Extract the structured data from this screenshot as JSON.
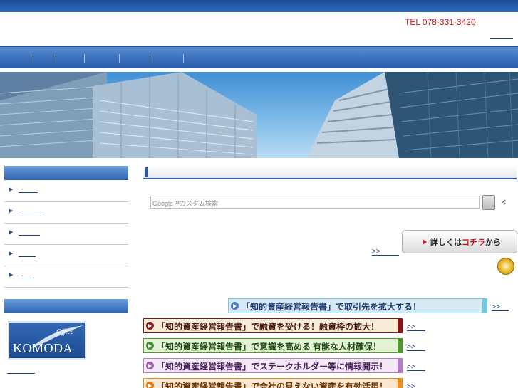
{
  "header": {
    "tel": "TEL 078-331-3420"
  },
  "search": {
    "brand": "Google™カスタム検索",
    "clear": "×"
  },
  "detail_button": {
    "prefix": "詳しくは",
    "highlight": "コチラ",
    "suffix": "から"
  },
  "more_label": ">>",
  "banners": [
    {
      "text": "「知的資産経営報告書」で取引先を拡大する！",
      "bg": "#d7eaf3",
      "color": "#1f3c73",
      "icon": "#4a7fc0",
      "accent": "#73c9e3"
    },
    {
      "text": "「知的資産経営報告書」で融資を受ける！融資枠の拡大！",
      "bg": "#f6ecd8",
      "color": "#4a1a10",
      "icon": "#8b1a1a",
      "accent": "#8b1414"
    },
    {
      "text": "「知的資産経営報告書」で意識を高める 有能な人材確保！",
      "bg": "#e5f2d6",
      "color": "#1d4a12",
      "icon": "#3f8f2a",
      "accent": "#4e9a2e"
    },
    {
      "text": "「知的資産経営報告書」でステークホルダー等に情報開示！",
      "bg": "#f3e8f6",
      "color": "#4a1f5e",
      "icon": "#9b5fb5",
      "accent": "#b57cc8"
    },
    {
      "text": "「知的資産経営報告書」で会社の見えない資産を有効活用！",
      "bg": "#fbe7cf",
      "color": "#6a3300",
      "icon": "#e07a12",
      "accent": "#f08c18"
    }
  ],
  "logo": {
    "office": "Office",
    "name": "KOMODA"
  }
}
